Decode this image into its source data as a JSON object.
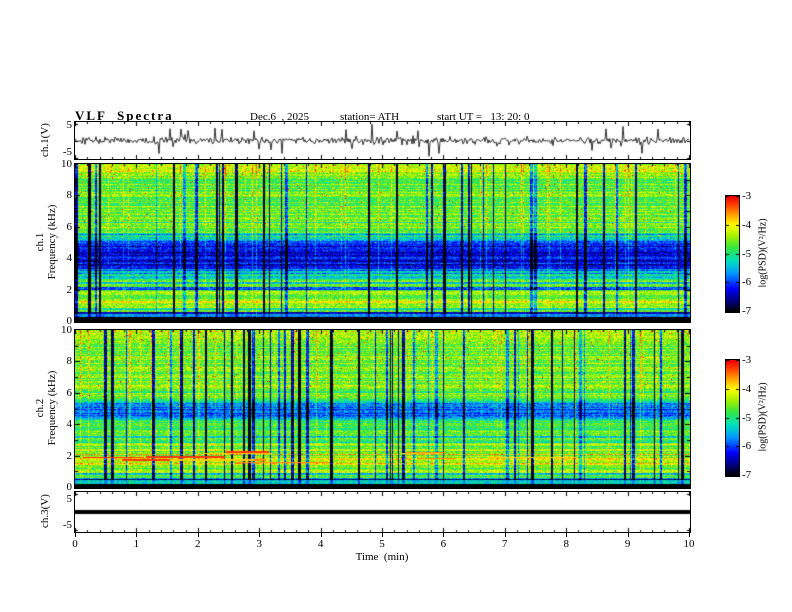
{
  "header": {
    "title": "VLF  Spectra",
    "date": "Dec.6  , 2025",
    "station": "station= ATH",
    "start_ut": "start UT =   13: 20: 0"
  },
  "xaxis": {
    "label": "Time  (min)",
    "ticks": [
      "0",
      "1",
      "2",
      "3",
      "4",
      "5",
      "6",
      "7",
      "8",
      "9",
      "10"
    ]
  },
  "panels": {
    "wave1": {
      "ylabel": "ch.1(V)",
      "yticks": [
        "5",
        "-5"
      ]
    },
    "spec1": {
      "ylabel_channel": "ch.1",
      "ylabel_axis": "Frequency (kHz)",
      "yticks": [
        "10",
        "8",
        "6",
        "4",
        "2",
        "0"
      ]
    },
    "spec2": {
      "ylabel_channel": "ch.2",
      "ylabel_axis": "Frequency (kHz)",
      "yticks": [
        "10",
        "8",
        "6",
        "4",
        "2",
        "0"
      ]
    },
    "wave3": {
      "ylabel": "ch.3(V)",
      "yticks": [
        "5",
        "-5"
      ]
    }
  },
  "colorbar": {
    "label": "log(PSD)(V²/Hz)",
    "ticks": [
      "-3",
      "-4",
      "-5",
      "-6",
      "-7"
    ],
    "range": [
      -7,
      -3
    ]
  },
  "colors": {
    "frame": "#000000",
    "background": "#ffffff",
    "colormap": [
      "#000000",
      "#00006e",
      "#0000ff",
      "#0096ff",
      "#00e1be",
      "#32e646",
      "#a0f000",
      "#ffff00",
      "#ff9600",
      "#ff3c00",
      "#eb0000"
    ]
  },
  "chart_data": [
    {
      "type": "line",
      "panel": "ch1_timeseries",
      "ylabel": "ch.1(V)",
      "ylim": [
        -5,
        5
      ],
      "xlim": [
        0,
        10
      ],
      "x_unit": "min",
      "series_summary": "broadband noise centered at 0 V with frequent impulsive spikes reaching about ±4.5 V throughout the 10-minute record"
    },
    {
      "type": "heatmap",
      "panel": "ch1_spectrogram",
      "ylabel": "ch.1 Frequency (kHz)",
      "ylim": [
        0,
        10
      ],
      "xlim": [
        0,
        10
      ],
      "x_unit": "min",
      "colorbar_label": "log(PSD)(V²/Hz)",
      "colorbar_range": [
        -7,
        -3
      ],
      "background_level_logpsd": -4.5,
      "features": [
        "diffuse green/yellow broadband noise background",
        "dense vertical blue streaks from impulsive sferics spanning all frequencies",
        "dark blue low-power band between about 3.3 and 5.1 kHz",
        "narrow horizontal interference lines between 2 and 3 kHz",
        "solid black band below about 0.3 kHz"
      ]
    },
    {
      "type": "heatmap",
      "panel": "ch2_spectrogram",
      "ylabel": "ch.2 Frequency (kHz)",
      "ylim": [
        0,
        10
      ],
      "xlim": [
        0,
        10
      ],
      "x_unit": "min",
      "colorbar_label": "log(PSD)(V²/Hz)",
      "colorbar_range": [
        -7,
        -3
      ],
      "background_level_logpsd": -4.5,
      "features": [
        "diffuse green broadband noise background",
        "vertical blue streaks from impulsive sferics",
        "dark blue low-power band between about 4.5 and 5.3 kHz",
        "bright yellow-to-red horizontal line segments between about 1.6 and 2.3 kHz",
        "horizontal striped structure from 1 to 3 kHz",
        "solid black band below about 0.25 kHz"
      ]
    },
    {
      "type": "line",
      "panel": "ch3_timeseries",
      "ylabel": "ch.3(V)",
      "ylim": [
        -5,
        5
      ],
      "xlim": [
        0,
        10
      ],
      "x_unit": "min",
      "values_constant": 0,
      "series_summary": "flat line at exactly 0 V for the entire record (dead channel)"
    }
  ]
}
